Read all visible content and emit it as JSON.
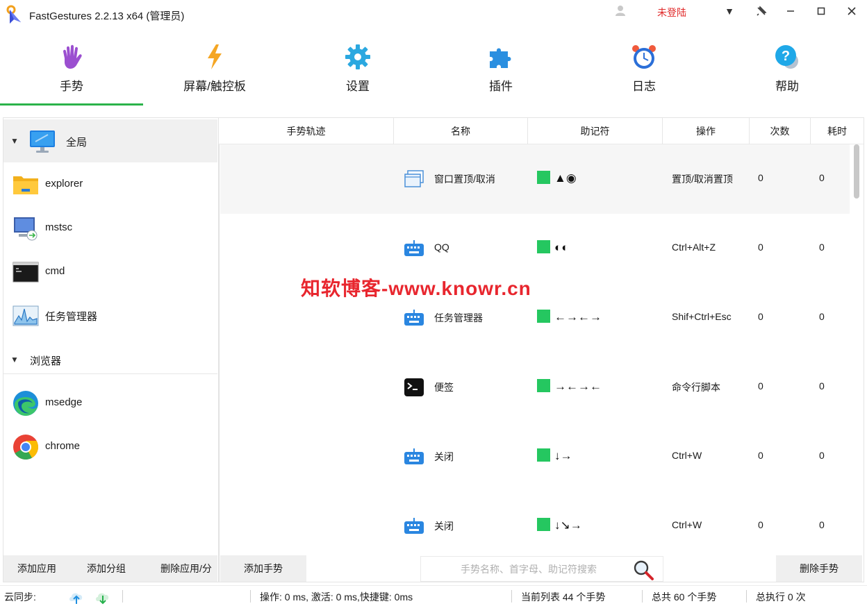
{
  "window": {
    "title": "FastGestures 2.2.13 x64  (管理员)",
    "login_status": "未登陆",
    "colors": {
      "accent_green": "#2bb34a",
      "mnemonic_green": "#25c760",
      "login_red": "#e02828",
      "watermark_red": "#e8262e"
    }
  },
  "tabs": [
    {
      "label": "手势",
      "icon": "hand-icon",
      "active": true
    },
    {
      "label": "屏幕/触控板",
      "icon": "lightning-icon",
      "active": false
    },
    {
      "label": "设置",
      "icon": "gear-icon",
      "active": false
    },
    {
      "label": "插件",
      "icon": "puzzle-icon",
      "active": false
    },
    {
      "label": "日志",
      "icon": "alarm-clock-icon",
      "active": false
    },
    {
      "label": "帮助",
      "icon": "help-icon",
      "active": false
    }
  ],
  "sidebar": {
    "items": [
      {
        "label": "全局",
        "icon": "monitor-icon"
      },
      {
        "label": "explorer",
        "icon": "folder-icon"
      },
      {
        "label": "mstsc",
        "icon": "remote-desktop-icon"
      },
      {
        "label": "cmd",
        "icon": "terminal-icon"
      },
      {
        "label": "任务管理器",
        "icon": "task-manager-icon"
      }
    ],
    "group": {
      "label": "浏览器",
      "expand_symbol": "▼"
    },
    "group_items": [
      {
        "label": "msedge",
        "icon": "edge-icon"
      },
      {
        "label": "chrome",
        "icon": "chrome-icon"
      }
    ],
    "expand_symbol": "▼",
    "buttons": {
      "add_app": "添加应用",
      "add_group": "添加分组",
      "delete_app": "删除应用/分"
    }
  },
  "table": {
    "headers": [
      "手势轨迹",
      "名称",
      "助记符",
      "操作",
      "次数",
      "耗时"
    ],
    "rows": [
      {
        "icon": "window-icon",
        "name": "窗口置顶/取消",
        "mnemonic": "▲◉",
        "action": "置顶/取消置顶",
        "count": "0",
        "time": "0"
      },
      {
        "icon": "keyboard-icon",
        "name": "QQ",
        "mnemonic": "◐◐",
        "action": "Ctrl+Alt+Z",
        "count": "0",
        "time": "0"
      },
      {
        "icon": "keyboard-icon",
        "name": "任务管理器",
        "mnemonic": "←→←→",
        "action": "Shif+Ctrl+Esc",
        "count": "0",
        "time": "0"
      },
      {
        "icon": "terminal-icon",
        "name": "便签",
        "mnemonic": "→←→←",
        "action": "命令行脚本",
        "count": "0",
        "time": "0"
      },
      {
        "icon": "keyboard-icon",
        "name": "关闭",
        "mnemonic": "↓→",
        "action": "Ctrl+W",
        "count": "0",
        "time": "0"
      },
      {
        "icon": "keyboard-icon",
        "name": "关闭",
        "mnemonic": "↓↘→",
        "action": "Ctrl+W",
        "count": "0",
        "time": "0"
      }
    ],
    "buttons": {
      "add_gesture": "添加手势",
      "delete_gesture": "删除手势"
    },
    "search_placeholder": "手势名称、首字母、助记符搜索"
  },
  "watermark": "知软博客-www.knowr.cn",
  "statusbar": {
    "cloud_sync": "云同步:",
    "timing": "操作: 0 ms, 激活: 0 ms,快捷键: 0ms",
    "current_list": "当前列表 44 个手势",
    "total": "总共 60 个手势",
    "executed": "总执行 0 次"
  }
}
